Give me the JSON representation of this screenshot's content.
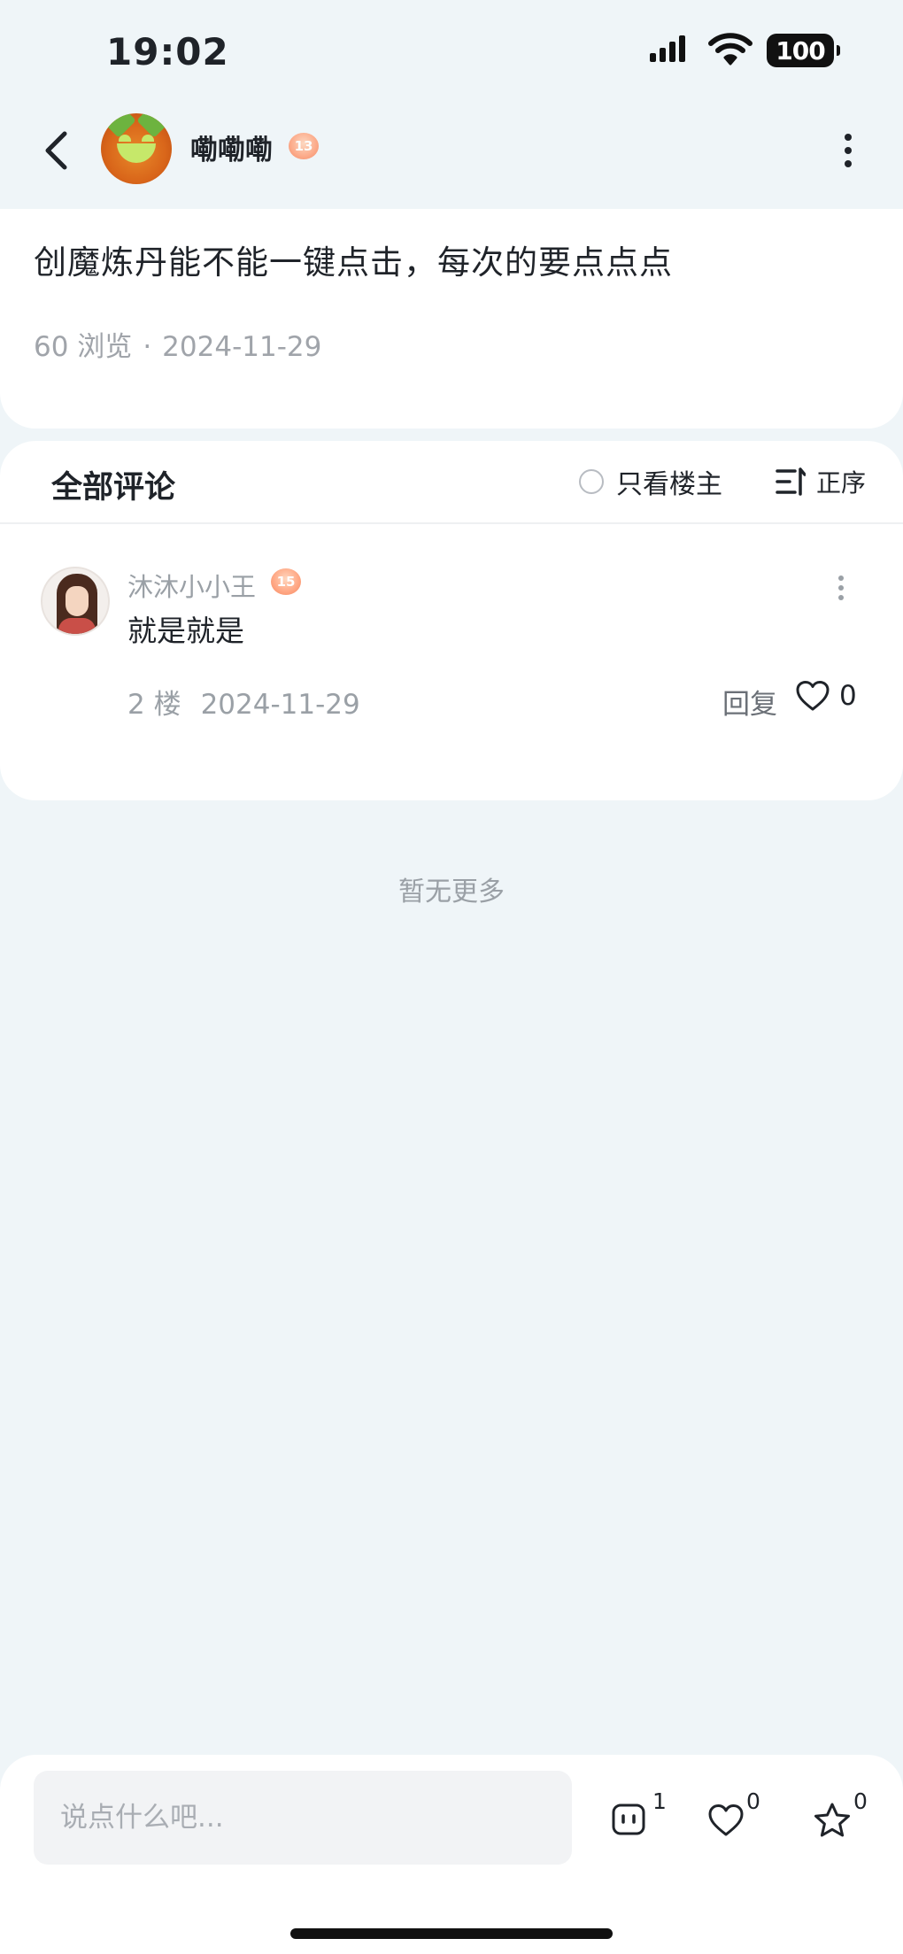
{
  "status_bar": {
    "time": "19:02",
    "battery": "100"
  },
  "header": {
    "author_name": "嘞嘞嘞",
    "author_level": "13"
  },
  "post": {
    "title": "创魔炼丹能不能一键点击，每次的要点点点",
    "views": "60 浏览",
    "separator": "·",
    "date": "2024-11-29"
  },
  "comments": {
    "title": "全部评论",
    "op_only_label": "只看楼主",
    "sort_label": "正序",
    "items": [
      {
        "name": "沐沐小小王",
        "level": "15",
        "text": "就是就是",
        "floor": "2 楼",
        "date": "2024-11-29",
        "reply_label": "回复",
        "likes": "0"
      }
    ],
    "no_more": "暂无更多"
  },
  "bottom_bar": {
    "input_placeholder": "说点什么吧...",
    "comment_count": "1",
    "like_count": "0",
    "favorite_count": "0"
  },
  "icons": [
    "back-icon",
    "more-vertical-icon",
    "radio-icon",
    "sort-icon",
    "heart-icon",
    "comment-icon",
    "star-icon",
    "signal-icon",
    "wifi-icon",
    "battery-icon"
  ]
}
